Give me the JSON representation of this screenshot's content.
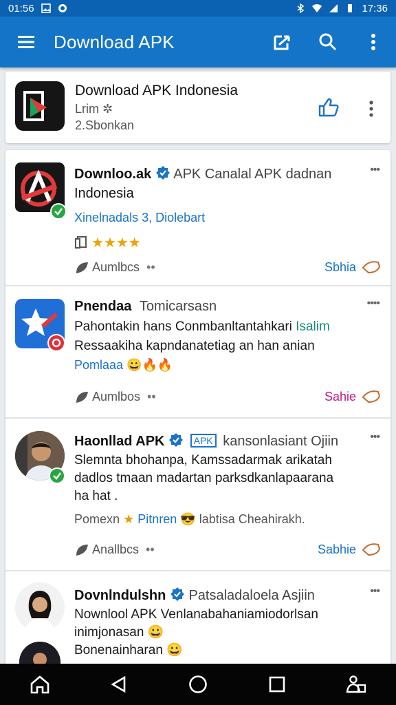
{
  "status_bar": {
    "time_left": "01:56",
    "time_right": "17:36"
  },
  "app_bar": {
    "title": "Download APK",
    "menu_icon": "hamburger-menu-icon",
    "actions": [
      "share-icon",
      "search-icon",
      "overflow-menu-icon"
    ]
  },
  "app_header": {
    "name": "Download APK Indonesia",
    "line1": "Lrim ✲",
    "line2": "2.Sbonkan"
  },
  "posts": [
    {
      "author": "Downloo.ak",
      "author_rest": "APK Canalal APK dadnan",
      "author_line2": "Indonesia",
      "subtitle": "Xinelnadals 3, Diolebart",
      "stars": "★★★★",
      "like_label": "Aumlbcs",
      "share_label": "Sbhia"
    },
    {
      "author": "Pnendaa",
      "author_rest": "Tomicarsasn",
      "body_line1": "Pahontakin hans Conmbanltantahkari",
      "body_line1_link": "Isalim",
      "body_line2": "Ressaakiha kapndanatetiag an han anian",
      "meta": "Pomlaaa 😀🔥🔥",
      "like_label": "Aumlbos",
      "share_label": "Sahie"
    },
    {
      "author": "Haonllad APK",
      "badge": "APK",
      "author_rest": "kansonlasiant Ojiin",
      "body_line1": "Slemnta bhohanpa, Kamssadarmak arikatah",
      "body_line2": "dadlos tmaan madartan parksdkanlapaarana",
      "body_line3": "ha hat .",
      "meta_a": "Pomexn",
      "meta_b": "Pitnren",
      "meta_c": "labtisa Cheahirakh.",
      "like_label": "Anallbcs",
      "share_label": "Sabhie"
    },
    {
      "author": "Dovnlndulshn",
      "author_rest": "Patsaladaloela Asjiin",
      "body_line1": "Nownlool APK Venlanabahaniamiodorlsan",
      "body_line2": "inimjonasan 😀",
      "body_line3": "Bonenainharan 😀"
    }
  ],
  "nav_bar": [
    "home-icon",
    "back-icon",
    "home-circle-icon",
    "recents-icon",
    "accessibility-icon"
  ],
  "colors": {
    "primary": "#1475c8",
    "status": "#0b62b3",
    "link": "#1a73c8",
    "verified": "#1a73c8",
    "check": "#26a641"
  }
}
